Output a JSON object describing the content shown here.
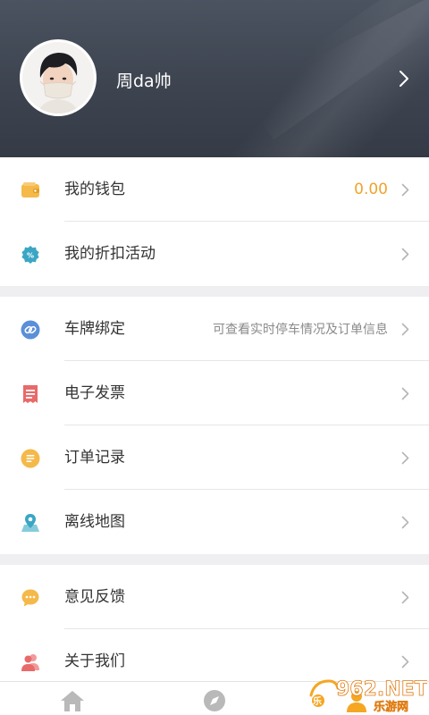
{
  "profile": {
    "username": "周da帅"
  },
  "menu_group_1": [
    {
      "id": "wallet",
      "label": "我的钱包",
      "value": "0.00",
      "icon": "wallet-icon"
    },
    {
      "id": "discount",
      "label": "我的折扣活动",
      "icon": "discount-badge-icon"
    }
  ],
  "menu_group_2": [
    {
      "id": "plate",
      "label": "车牌绑定",
      "hint": "可查看实时停车情况及订单信息",
      "icon": "link-icon"
    },
    {
      "id": "invoice",
      "label": "电子发票",
      "icon": "receipt-icon"
    },
    {
      "id": "orders",
      "label": "订单记录",
      "icon": "list-icon"
    },
    {
      "id": "offline_map",
      "label": "离线地图",
      "icon": "map-pin-icon"
    }
  ],
  "menu_group_3": [
    {
      "id": "feedback",
      "label": "意见反馈",
      "icon": "chat-bubble-icon"
    },
    {
      "id": "about",
      "label": "关于我们",
      "icon": "people-icon"
    }
  ],
  "bottom_nav": {
    "items": [
      {
        "id": "home",
        "icon": "home-icon"
      },
      {
        "id": "discover",
        "icon": "compass-icon"
      },
      {
        "id": "me",
        "icon": "user-icon"
      }
    ]
  },
  "watermark": {
    "brand": "962.NET",
    "sub": "乐游网"
  },
  "colors": {
    "header_bg": "#3d4450",
    "accent_value": "#f0a32b",
    "wallet_icon": "#f5b94a",
    "discount_icon": "#3aa6c4",
    "link_icon": "#5b8fd8",
    "receipt_icon": "#e86a6a",
    "list_icon": "#f5b94a",
    "map_icon": "#3aa6c4",
    "chat_icon": "#f5b94a",
    "people_icon": "#e86a6a"
  }
}
